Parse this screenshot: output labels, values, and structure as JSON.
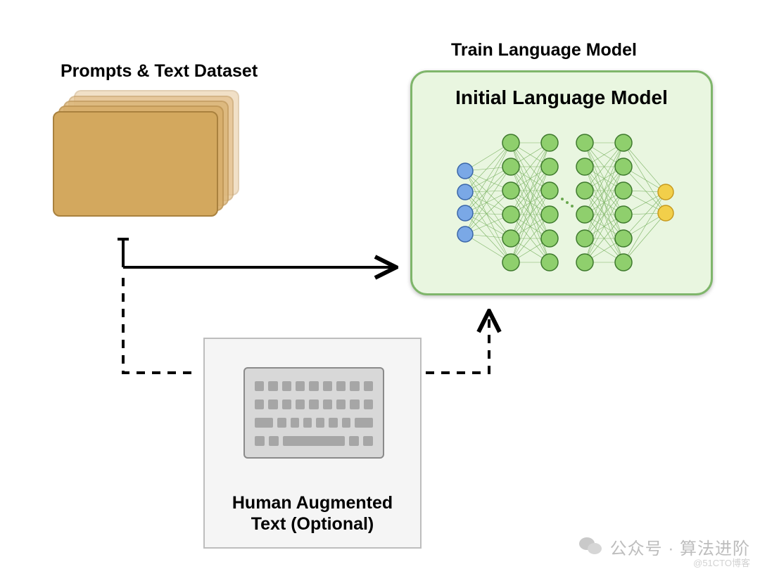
{
  "labels": {
    "dataset": "Prompts & Text Dataset",
    "train": "Train Language Model",
    "model_title": "Initial Language Model",
    "augmented_line1": "Human Augmented",
    "augmented_line2": "Text (Optional)"
  },
  "watermark": {
    "main": "公众号 · 算法进阶",
    "sub": "@51CTO博客"
  },
  "colors": {
    "model_bg": "#e9f6e0",
    "model_border": "#7fb66b",
    "node_green": "#8fcf6d",
    "node_blue": "#7aa8e6",
    "node_yellow": "#f2cf4a",
    "card": "#d3a85e",
    "aug_bg": "#f5f5f5"
  },
  "diagram": {
    "flow": [
      {
        "from": "dataset",
        "to": "model",
        "style": "solid"
      },
      {
        "from": "dataset",
        "to": "augmented",
        "style": "dashed"
      },
      {
        "from": "augmented",
        "to": "model",
        "style": "dashed"
      }
    ],
    "nn_layers": {
      "input_blue": 4,
      "hidden_green": [
        6,
        6,
        6,
        6
      ],
      "output_yellow": 2
    }
  }
}
